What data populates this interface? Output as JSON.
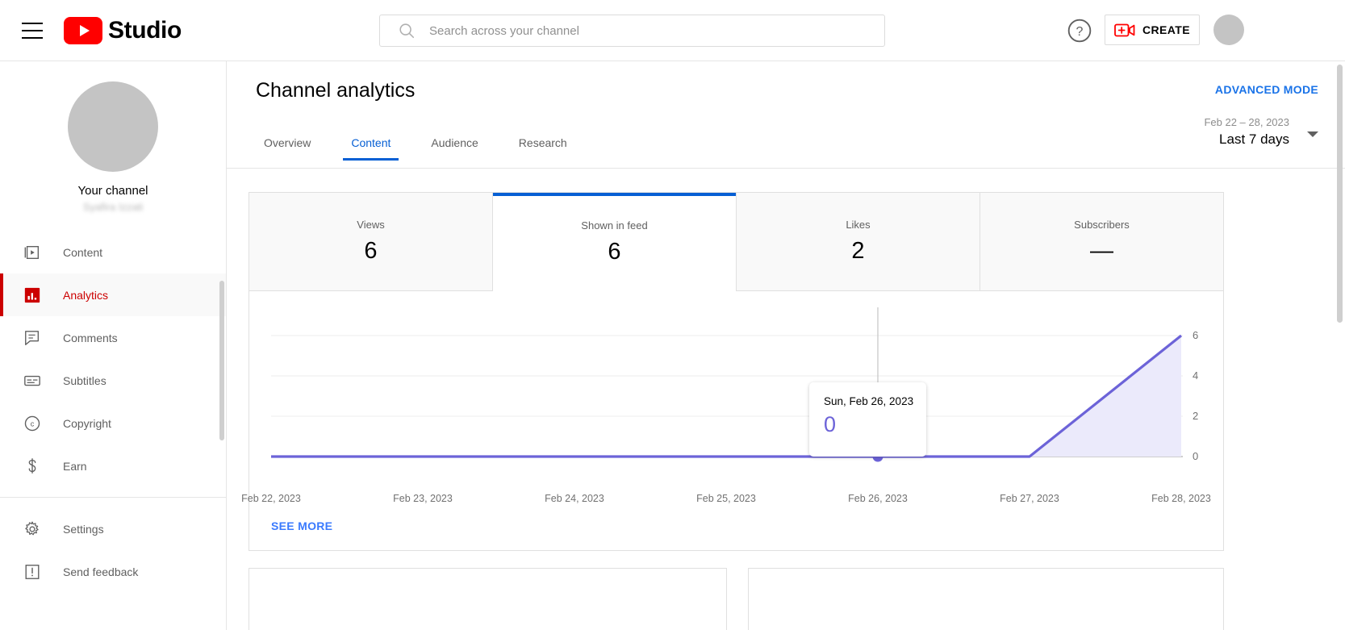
{
  "header": {
    "menu_icon": "hamburger-icon",
    "logo_text": "Studio",
    "search_placeholder": "Search across your channel",
    "search_value": "",
    "search_icon": "search-icon",
    "help_icon": "help-circle-icon",
    "create_label": "CREATE",
    "create_icon": "video-plus-icon",
    "avatar": "account-avatar"
  },
  "sidebar": {
    "channel_title": "Your channel",
    "channel_name": "Syafira Izzati",
    "items": [
      {
        "label": "Content",
        "icon": "content-icon",
        "active": false
      },
      {
        "label": "Analytics",
        "icon": "analytics-icon",
        "active": true
      },
      {
        "label": "Comments",
        "icon": "comments-icon",
        "active": false
      },
      {
        "label": "Subtitles",
        "icon": "subtitles-icon",
        "active": false
      },
      {
        "label": "Copyright",
        "icon": "copyright-icon",
        "active": false
      },
      {
        "label": "Earn",
        "icon": "dollar-icon",
        "active": false
      }
    ],
    "footer_items": [
      {
        "label": "Settings",
        "icon": "gear-icon"
      },
      {
        "label": "Send feedback",
        "icon": "feedback-icon"
      }
    ]
  },
  "main": {
    "page_title": "Channel analytics",
    "advanced_mode": "ADVANCED MODE",
    "tabs": [
      {
        "label": "Overview",
        "active": false
      },
      {
        "label": "Content",
        "active": true
      },
      {
        "label": "Audience",
        "active": false
      },
      {
        "label": "Research",
        "active": false
      }
    ],
    "date_range": "Feb 22 – 28, 2023",
    "date_label": "Last 7 days",
    "see_more": "SEE MORE"
  },
  "metrics": [
    {
      "label": "Views",
      "value": "6",
      "selected": false
    },
    {
      "label": "Shown in feed",
      "value": "6",
      "selected": true
    },
    {
      "label": "Likes",
      "value": "2",
      "selected": false
    },
    {
      "label": "Subscribers",
      "value": "—",
      "selected": false
    }
  ],
  "tooltip": {
    "date": "Sun, Feb 26, 2023",
    "value": "0"
  },
  "chart_data": {
    "type": "area",
    "title": "Shown in feed",
    "xlabel": "",
    "ylabel": "",
    "x": [
      "Feb 22, 2023",
      "Feb 23, 2023",
      "Feb 24, 2023",
      "Feb 25, 2023",
      "Feb 26, 2023",
      "Feb 27, 2023",
      "Feb 28, 2023"
    ],
    "values": [
      0,
      0,
      0,
      0,
      0,
      0,
      6
    ],
    "yticks": [
      0,
      2,
      4,
      6
    ],
    "ylim": [
      0,
      6
    ],
    "grid": true,
    "legend": "none",
    "line_color": "#6c63d8",
    "fill_color": "#ebeafb",
    "highlight_index": 4,
    "highlight_value": "0"
  },
  "colors": {
    "brand_red": "#ff0000",
    "accent_blue": "#065fd4",
    "link_blue": "#3a7afe",
    "active_red": "#cc0000",
    "chart_purple": "#6c63d8"
  }
}
